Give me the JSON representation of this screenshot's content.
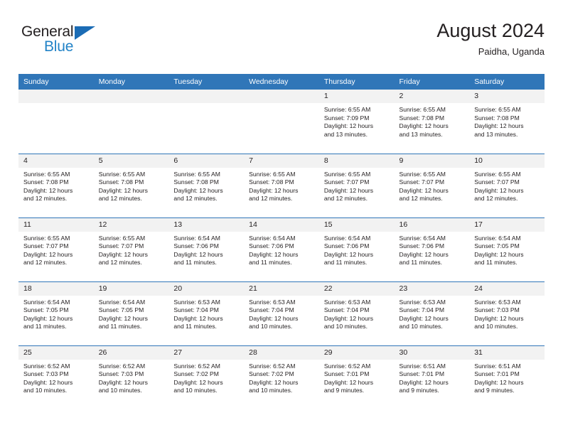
{
  "brand": {
    "name_part1": "General",
    "name_part2": "Blue",
    "triangle_icon": "triangle-icon",
    "color_dark": "#231f20",
    "color_blue": "#2283c7"
  },
  "header": {
    "title": "August 2024",
    "subtitle": "Paidha, Uganda"
  },
  "theme": {
    "header_bg": "#3076b8",
    "daynum_bg": "#f2f2f2",
    "text": "#231f20"
  },
  "calendar": {
    "weekday_headers": [
      "Sunday",
      "Monday",
      "Tuesday",
      "Wednesday",
      "Thursday",
      "Friday",
      "Saturday"
    ],
    "weeks": [
      [
        {
          "day": "",
          "empty": true,
          "sunrise": "",
          "sunset": "",
          "daylight_1": "",
          "daylight_2": ""
        },
        {
          "day": "",
          "empty": true,
          "sunrise": "",
          "sunset": "",
          "daylight_1": "",
          "daylight_2": ""
        },
        {
          "day": "",
          "empty": true,
          "sunrise": "",
          "sunset": "",
          "daylight_1": "",
          "daylight_2": ""
        },
        {
          "day": "",
          "empty": true,
          "sunrise": "",
          "sunset": "",
          "daylight_1": "",
          "daylight_2": ""
        },
        {
          "day": "1",
          "empty": false,
          "sunrise": "Sunrise: 6:55 AM",
          "sunset": "Sunset: 7:09 PM",
          "daylight_1": "Daylight: 12 hours",
          "daylight_2": "and 13 minutes."
        },
        {
          "day": "2",
          "empty": false,
          "sunrise": "Sunrise: 6:55 AM",
          "sunset": "Sunset: 7:08 PM",
          "daylight_1": "Daylight: 12 hours",
          "daylight_2": "and 13 minutes."
        },
        {
          "day": "3",
          "empty": false,
          "sunrise": "Sunrise: 6:55 AM",
          "sunset": "Sunset: 7:08 PM",
          "daylight_1": "Daylight: 12 hours",
          "daylight_2": "and 13 minutes."
        }
      ],
      [
        {
          "day": "4",
          "empty": false,
          "sunrise": "Sunrise: 6:55 AM",
          "sunset": "Sunset: 7:08 PM",
          "daylight_1": "Daylight: 12 hours",
          "daylight_2": "and 12 minutes."
        },
        {
          "day": "5",
          "empty": false,
          "sunrise": "Sunrise: 6:55 AM",
          "sunset": "Sunset: 7:08 PM",
          "daylight_1": "Daylight: 12 hours",
          "daylight_2": "and 12 minutes."
        },
        {
          "day": "6",
          "empty": false,
          "sunrise": "Sunrise: 6:55 AM",
          "sunset": "Sunset: 7:08 PM",
          "daylight_1": "Daylight: 12 hours",
          "daylight_2": "and 12 minutes."
        },
        {
          "day": "7",
          "empty": false,
          "sunrise": "Sunrise: 6:55 AM",
          "sunset": "Sunset: 7:08 PM",
          "daylight_1": "Daylight: 12 hours",
          "daylight_2": "and 12 minutes."
        },
        {
          "day": "8",
          "empty": false,
          "sunrise": "Sunrise: 6:55 AM",
          "sunset": "Sunset: 7:07 PM",
          "daylight_1": "Daylight: 12 hours",
          "daylight_2": "and 12 minutes."
        },
        {
          "day": "9",
          "empty": false,
          "sunrise": "Sunrise: 6:55 AM",
          "sunset": "Sunset: 7:07 PM",
          "daylight_1": "Daylight: 12 hours",
          "daylight_2": "and 12 minutes."
        },
        {
          "day": "10",
          "empty": false,
          "sunrise": "Sunrise: 6:55 AM",
          "sunset": "Sunset: 7:07 PM",
          "daylight_1": "Daylight: 12 hours",
          "daylight_2": "and 12 minutes."
        }
      ],
      [
        {
          "day": "11",
          "empty": false,
          "sunrise": "Sunrise: 6:55 AM",
          "sunset": "Sunset: 7:07 PM",
          "daylight_1": "Daylight: 12 hours",
          "daylight_2": "and 12 minutes."
        },
        {
          "day": "12",
          "empty": false,
          "sunrise": "Sunrise: 6:55 AM",
          "sunset": "Sunset: 7:07 PM",
          "daylight_1": "Daylight: 12 hours",
          "daylight_2": "and 12 minutes."
        },
        {
          "day": "13",
          "empty": false,
          "sunrise": "Sunrise: 6:54 AM",
          "sunset": "Sunset: 7:06 PM",
          "daylight_1": "Daylight: 12 hours",
          "daylight_2": "and 11 minutes."
        },
        {
          "day": "14",
          "empty": false,
          "sunrise": "Sunrise: 6:54 AM",
          "sunset": "Sunset: 7:06 PM",
          "daylight_1": "Daylight: 12 hours",
          "daylight_2": "and 11 minutes."
        },
        {
          "day": "15",
          "empty": false,
          "sunrise": "Sunrise: 6:54 AM",
          "sunset": "Sunset: 7:06 PM",
          "daylight_1": "Daylight: 12 hours",
          "daylight_2": "and 11 minutes."
        },
        {
          "day": "16",
          "empty": false,
          "sunrise": "Sunrise: 6:54 AM",
          "sunset": "Sunset: 7:06 PM",
          "daylight_1": "Daylight: 12 hours",
          "daylight_2": "and 11 minutes."
        },
        {
          "day": "17",
          "empty": false,
          "sunrise": "Sunrise: 6:54 AM",
          "sunset": "Sunset: 7:05 PM",
          "daylight_1": "Daylight: 12 hours",
          "daylight_2": "and 11 minutes."
        }
      ],
      [
        {
          "day": "18",
          "empty": false,
          "sunrise": "Sunrise: 6:54 AM",
          "sunset": "Sunset: 7:05 PM",
          "daylight_1": "Daylight: 12 hours",
          "daylight_2": "and 11 minutes."
        },
        {
          "day": "19",
          "empty": false,
          "sunrise": "Sunrise: 6:54 AM",
          "sunset": "Sunset: 7:05 PM",
          "daylight_1": "Daylight: 12 hours",
          "daylight_2": "and 11 minutes."
        },
        {
          "day": "20",
          "empty": false,
          "sunrise": "Sunrise: 6:53 AM",
          "sunset": "Sunset: 7:04 PM",
          "daylight_1": "Daylight: 12 hours",
          "daylight_2": "and 11 minutes."
        },
        {
          "day": "21",
          "empty": false,
          "sunrise": "Sunrise: 6:53 AM",
          "sunset": "Sunset: 7:04 PM",
          "daylight_1": "Daylight: 12 hours",
          "daylight_2": "and 10 minutes."
        },
        {
          "day": "22",
          "empty": false,
          "sunrise": "Sunrise: 6:53 AM",
          "sunset": "Sunset: 7:04 PM",
          "daylight_1": "Daylight: 12 hours",
          "daylight_2": "and 10 minutes."
        },
        {
          "day": "23",
          "empty": false,
          "sunrise": "Sunrise: 6:53 AM",
          "sunset": "Sunset: 7:04 PM",
          "daylight_1": "Daylight: 12 hours",
          "daylight_2": "and 10 minutes."
        },
        {
          "day": "24",
          "empty": false,
          "sunrise": "Sunrise: 6:53 AM",
          "sunset": "Sunset: 7:03 PM",
          "daylight_1": "Daylight: 12 hours",
          "daylight_2": "and 10 minutes."
        }
      ],
      [
        {
          "day": "25",
          "empty": false,
          "sunrise": "Sunrise: 6:52 AM",
          "sunset": "Sunset: 7:03 PM",
          "daylight_1": "Daylight: 12 hours",
          "daylight_2": "and 10 minutes."
        },
        {
          "day": "26",
          "empty": false,
          "sunrise": "Sunrise: 6:52 AM",
          "sunset": "Sunset: 7:03 PM",
          "daylight_1": "Daylight: 12 hours",
          "daylight_2": "and 10 minutes."
        },
        {
          "day": "27",
          "empty": false,
          "sunrise": "Sunrise: 6:52 AM",
          "sunset": "Sunset: 7:02 PM",
          "daylight_1": "Daylight: 12 hours",
          "daylight_2": "and 10 minutes."
        },
        {
          "day": "28",
          "empty": false,
          "sunrise": "Sunrise: 6:52 AM",
          "sunset": "Sunset: 7:02 PM",
          "daylight_1": "Daylight: 12 hours",
          "daylight_2": "and 10 minutes."
        },
        {
          "day": "29",
          "empty": false,
          "sunrise": "Sunrise: 6:52 AM",
          "sunset": "Sunset: 7:01 PM",
          "daylight_1": "Daylight: 12 hours",
          "daylight_2": "and 9 minutes."
        },
        {
          "day": "30",
          "empty": false,
          "sunrise": "Sunrise: 6:51 AM",
          "sunset": "Sunset: 7:01 PM",
          "daylight_1": "Daylight: 12 hours",
          "daylight_2": "and 9 minutes."
        },
        {
          "day": "31",
          "empty": false,
          "sunrise": "Sunrise: 6:51 AM",
          "sunset": "Sunset: 7:01 PM",
          "daylight_1": "Daylight: 12 hours",
          "daylight_2": "and 9 minutes."
        }
      ]
    ]
  }
}
